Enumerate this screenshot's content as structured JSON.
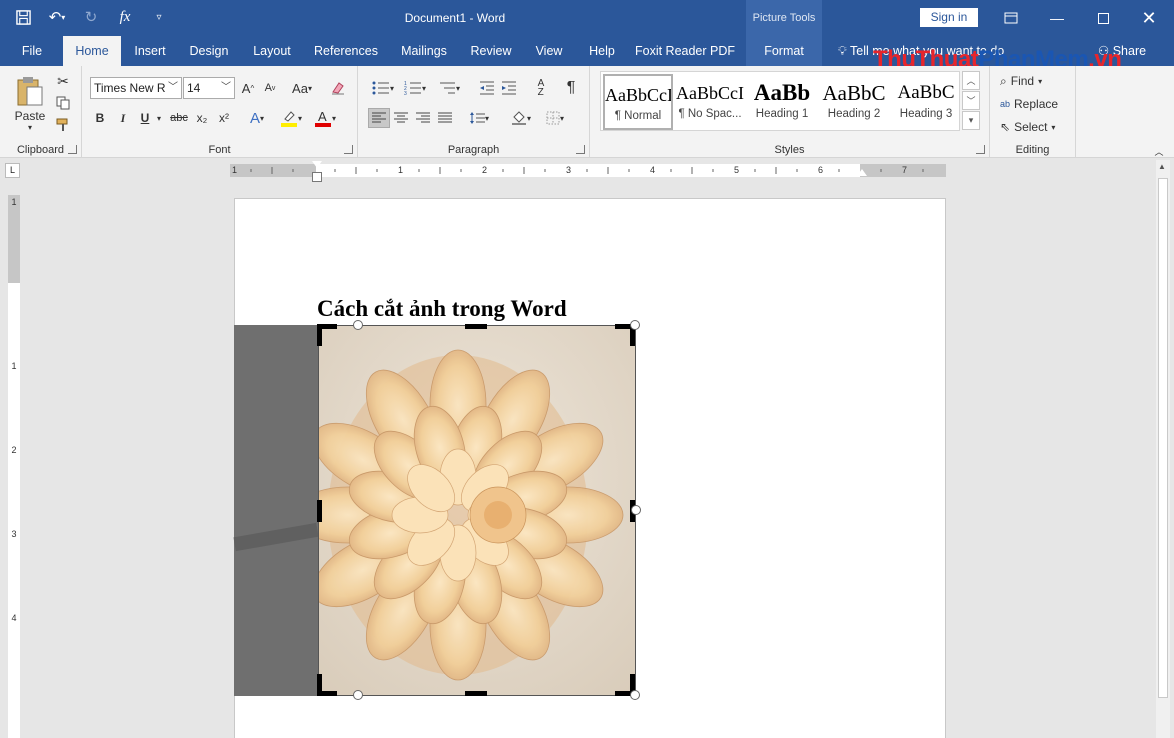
{
  "titlebar": {
    "document_title": "Document1  -  Word",
    "context_tab_group": "Picture Tools",
    "sign_in": "Sign in"
  },
  "tabs": [
    "File",
    "Home",
    "Insert",
    "Design",
    "Layout",
    "References",
    "Mailings",
    "Review",
    "View",
    "Help",
    "Foxit Reader PDF",
    "Format"
  ],
  "active_tab": "Home",
  "tell_me": "Tell me what you want to do",
  "share": "Share",
  "watermark": {
    "part1": "ThuThuat",
    "part2": "PhanMem",
    "part3": ".vn"
  },
  "ribbon": {
    "clipboard": {
      "paste": "Paste",
      "label": "Clipboard"
    },
    "font": {
      "name": "Times New R",
      "size": "14",
      "change_case": "Aa",
      "label": "Font",
      "bold": "B",
      "italic": "I",
      "underline": "U",
      "strike": "abc",
      "sub": "x₂",
      "sup": "x²"
    },
    "paragraph": {
      "label": "Paragraph"
    },
    "styles": {
      "label": "Styles",
      "items": [
        {
          "preview": "AaBbCcI",
          "name": "¶ Normal"
        },
        {
          "preview": "AaBbCcI",
          "name": "¶ No Spac..."
        },
        {
          "preview": "AaBb",
          "name": "Heading 1"
        },
        {
          "preview": "AaBbC",
          "name": "Heading 2"
        },
        {
          "preview": "AaBbC",
          "name": "Heading 3"
        }
      ]
    },
    "editing": {
      "find": "Find",
      "replace": "Replace",
      "select": "Select",
      "label": "Editing"
    }
  },
  "ruler": {
    "h_numbers": [
      "1",
      "1",
      "2",
      "3",
      "4",
      "5",
      "6",
      "7"
    ],
    "v_numbers": [
      "1",
      "1",
      "2",
      "3",
      "4"
    ]
  },
  "document": {
    "heading": "Cách cắt ảnh trong Word"
  },
  "colors": {
    "brand": "#2b579a",
    "ribbon": "#f3f3f3",
    "page_bg": "#e6e6e6",
    "watermark_a": "#e8252b",
    "watermark_b": "#1a56b3"
  }
}
